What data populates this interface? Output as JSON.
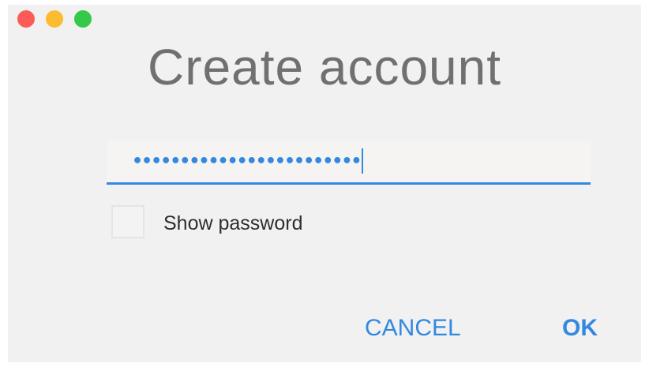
{
  "window": {
    "title": "Create account",
    "traffic_lights": [
      {
        "name": "close",
        "color": "#fc5b57"
      },
      {
        "name": "minimize",
        "color": "#fdbc2f"
      },
      {
        "name": "maximize",
        "color": "#35c94a"
      }
    ]
  },
  "password_field": {
    "value": "••••••••••••••••••••••••",
    "masked": true,
    "focused": true,
    "accent_color": "#3388e0"
  },
  "show_password": {
    "label": "Show password",
    "checked": false
  },
  "buttons": {
    "cancel_label": "CANCEL",
    "ok_label": "OK"
  }
}
